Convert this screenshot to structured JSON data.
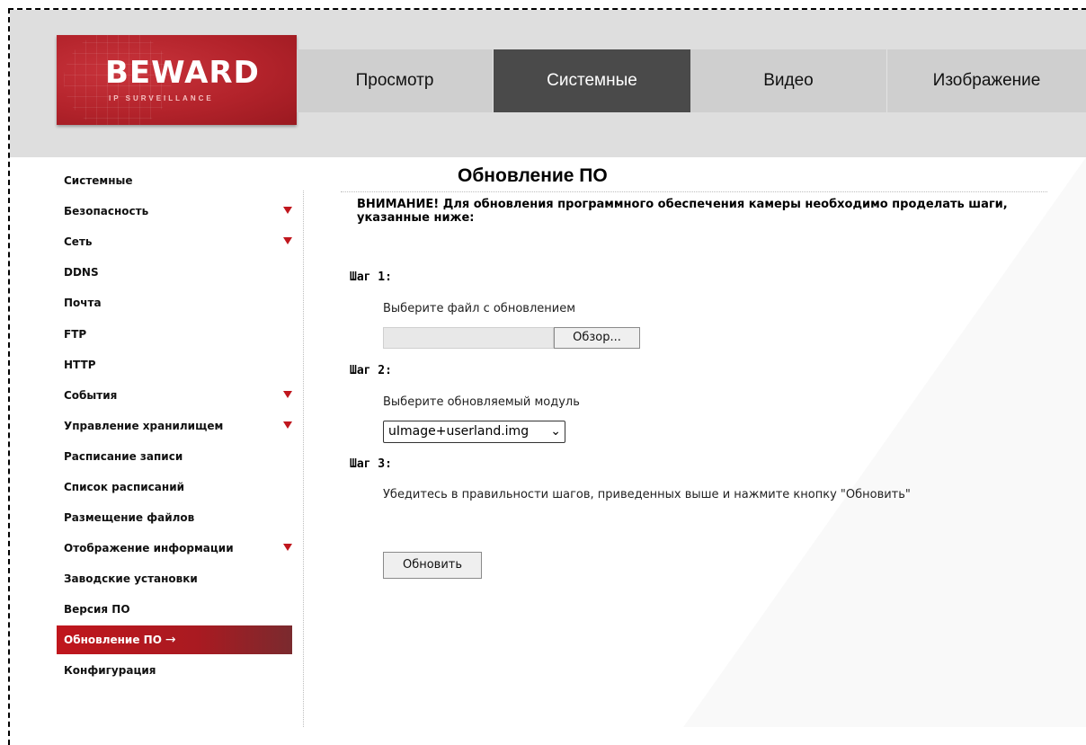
{
  "brand": {
    "name": "BEWARD",
    "tagline": "IP SURVEILLANCE"
  },
  "nav": {
    "tabs": [
      {
        "label": "Просмотр",
        "active": false
      },
      {
        "label": "Системные",
        "active": true
      },
      {
        "label": "Видео",
        "active": false
      },
      {
        "label": "Изображение",
        "active": false
      }
    ]
  },
  "sidebar": {
    "items": [
      {
        "label": "Системные",
        "expandable": false
      },
      {
        "label": "Безопасность",
        "expandable": true
      },
      {
        "label": "Сеть",
        "expandable": true
      },
      {
        "label": "DDNS",
        "expandable": false
      },
      {
        "label": "Почта",
        "expandable": false
      },
      {
        "label": "FTP",
        "expandable": false
      },
      {
        "label": "HTTP",
        "expandable": false
      },
      {
        "label": "События",
        "expandable": true
      },
      {
        "label": "Управление хранилищем",
        "expandable": true
      },
      {
        "label": "Расписание записи",
        "expandable": false
      },
      {
        "label": "Список расписаний",
        "expandable": false
      },
      {
        "label": "Размещение файлов",
        "expandable": false
      },
      {
        "label": "Отображение информации",
        "expandable": true
      },
      {
        "label": "Заводские установки",
        "expandable": false
      },
      {
        "label": "Версия ПО",
        "expandable": false
      },
      {
        "label": "Обновление ПО",
        "expandable": false,
        "active": true
      },
      {
        "label": "Конфигурация",
        "expandable": false
      }
    ]
  },
  "main": {
    "title": "Обновление ПО",
    "warning": "ВНИМАНИЕ! Для обновления программного обеспечения камеры необходимо проделать шаги, указанные ниже:",
    "step1": {
      "label": "Шаг 1:",
      "text": "Выберите файл с обновлением",
      "browse_label": "Обзор..."
    },
    "step2": {
      "label": "Шаг 2:",
      "text": "Выберите обновляемый модуль",
      "selected": "uImage+userland.img"
    },
    "step3": {
      "label": "Шаг 3:",
      "text": "Убедитесь в правильности шагов, приведенных выше и нажмите кнопку \"Обновить\""
    },
    "update_label": "Обновить"
  },
  "colors": {
    "accent": "#c0161d",
    "active_tab": "#4a4a4a",
    "header_bg": "#dedede"
  }
}
